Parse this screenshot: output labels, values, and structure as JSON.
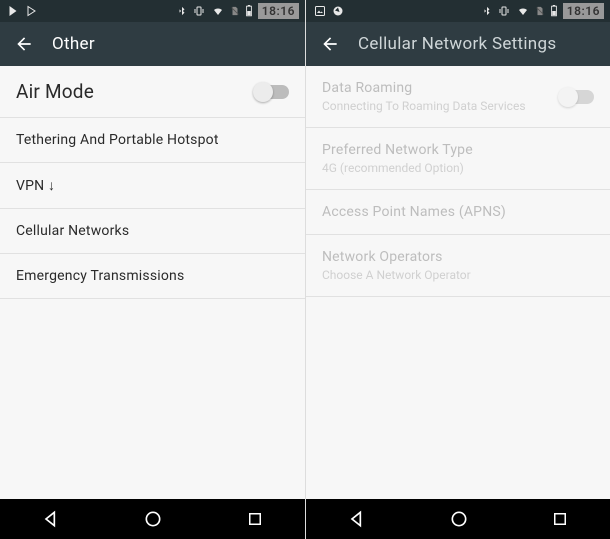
{
  "left": {
    "status": {
      "time": "18:16"
    },
    "appbar": {
      "title": "Other"
    },
    "rows": {
      "air_mode": "Air Mode",
      "tethering": "Tethering And Portable Hotspot",
      "vpn": "VPN ↓",
      "cellular": "Cellular Networks",
      "emergency": "Emergency Transmissions"
    }
  },
  "right": {
    "status": {
      "time": "18:16"
    },
    "appbar": {
      "title": "Cellular Network Settings"
    },
    "rows": {
      "roaming_title": "Data Roaming",
      "roaming_sub": "Connecting To Roaming Data Services",
      "pref_title": "Preferred Network Type",
      "pref_sub": "4G (recommended Option)",
      "apn_title": "Access Point Names (APNS)",
      "ops_title": "Network Operators",
      "ops_sub": "Choose A Network Operator"
    }
  }
}
